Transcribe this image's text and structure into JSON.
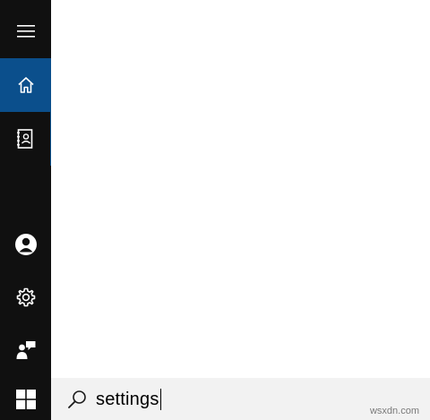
{
  "rail": {
    "items": [
      {
        "name": "menu",
        "icon": "hamburger-menu-icon"
      },
      {
        "name": "home",
        "icon": "home-icon",
        "selected": true
      },
      {
        "name": "notebook",
        "icon": "notebook-icon"
      },
      {
        "name": "account",
        "icon": "user-icon"
      },
      {
        "name": "settings",
        "icon": "gear-icon"
      },
      {
        "name": "feedback",
        "icon": "feedback-icon"
      }
    ],
    "colors": {
      "background": "#101010",
      "selected": "#0b4f8c",
      "icon": "#ffffff"
    }
  },
  "taskbar": {
    "start_icon": "windows-logo-icon"
  },
  "search": {
    "icon": "search-icon",
    "value": "settings"
  },
  "watermark": {
    "text": "wsxdn.com"
  }
}
